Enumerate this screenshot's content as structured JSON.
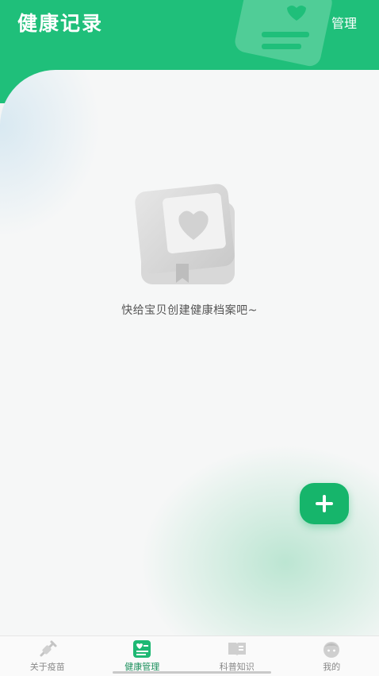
{
  "header": {
    "title": "健康记录",
    "manage_label": "管理"
  },
  "empty_state": {
    "message": "快给宝贝创建健康档案吧~",
    "illustration": "heart-book-icon"
  },
  "add_button": {
    "icon": "plus-icon"
  },
  "tabbar": {
    "items": [
      {
        "label": "关于疫苗",
        "icon": "syringe-icon",
        "active": false
      },
      {
        "label": "健康管理",
        "icon": "health-record-icon",
        "active": true
      },
      {
        "label": "科普知识",
        "icon": "open-book-icon",
        "active": false
      },
      {
        "label": "我的",
        "icon": "baby-face-icon",
        "active": false
      }
    ]
  },
  "colors": {
    "accent": "#1fbf7a",
    "button": "#16b56b",
    "active_tab_text": "#1b8f5c"
  }
}
